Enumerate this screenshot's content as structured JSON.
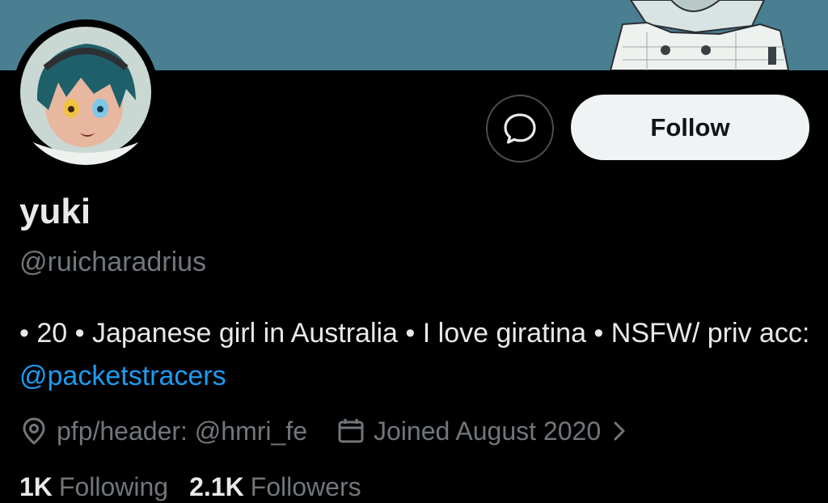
{
  "colors": {
    "background": "#000000",
    "banner": "#4a7f92",
    "primary_text": "#e7e9ea",
    "secondary_text": "#71767b",
    "link": "#1d9bf0",
    "follow_button_bg": "#eff3f4",
    "follow_button_text": "#0f1419"
  },
  "profile": {
    "display_name": "yuki",
    "handle": "@ruicharadrius",
    "bio_text": "• 20 • Japanese girl in Australia • I love giratina • NSFW/ priv acc: ",
    "bio_mention": "@packetstracers",
    "location_icon": "location-pin-icon",
    "location": "pfp/header: @hmri_fe",
    "joined_icon": "calendar-icon",
    "joined": "Joined August 2020",
    "joined_chevron_icon": "chevron-right-icon"
  },
  "actions": {
    "message_icon": "message-bubble-icon",
    "follow_label": "Follow"
  },
  "stats": {
    "following_count": "1K",
    "following_label": "Following",
    "followers_count": "2.1K",
    "followers_label": "Followers"
  }
}
